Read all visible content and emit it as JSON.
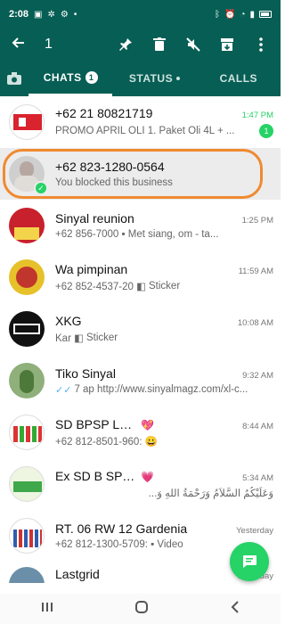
{
  "status_bar": {
    "time": "2:08"
  },
  "action_bar": {
    "selected_count": "1"
  },
  "tabs": {
    "chats": "CHATS",
    "chats_badge": "1",
    "status": "STATUS",
    "calls": "CALLS"
  },
  "chats": [
    {
      "name": "+62 21 80821719",
      "time": "1:47 PM",
      "preview": "PROMO APRIL OLI   1. Paket Oli 4L + ...",
      "unread": "1"
    },
    {
      "name": "+62 823-1280-0564",
      "time": "",
      "preview": "You blocked this business"
    },
    {
      "name": "Sinyal reunion",
      "time": "1:25 PM",
      "preview_prefix": "+62 856-7000",
      "preview": "Met siang, om - ta..."
    },
    {
      "name": "Wa   pimpinan",
      "time": "11:59 AM",
      "preview_prefix": "+62 852-4537-20",
      "preview": "Sticker"
    },
    {
      "name": "XKG",
      "time": "10:08 AM",
      "preview_prefix": "Kar",
      "preview": "Sticker"
    },
    {
      "name": "Tiko Sinyal",
      "time": "9:32 AM",
      "preview": "7 ap http://www.sinyalmagz.com/xl-c..."
    },
    {
      "name": "SD BPSP LAWAS ASLI",
      "time": "8:44 AM",
      "preview_prefix": "+62 812-8501-960:",
      "preview": "😀"
    },
    {
      "name": "Ex SD B    SP  Ma   ng",
      "time": "5:34 AM",
      "preview": "وَعَلَيْكُمُ السَّلاَمُ وَرَحْمَةُ اللهِ وَ..."
    },
    {
      "name": "RT. 06 RW 12 Gardenia",
      "time": "Yesterday",
      "preview_prefix": "+62 812-1300-5709:",
      "preview": "Video"
    },
    {
      "name": "Lastgrid",
      "time": "Yesterday",
      "preview": ""
    }
  ],
  "colors": {
    "header": "#075e54",
    "accent": "#25d366",
    "highlight": "#f08a30"
  }
}
